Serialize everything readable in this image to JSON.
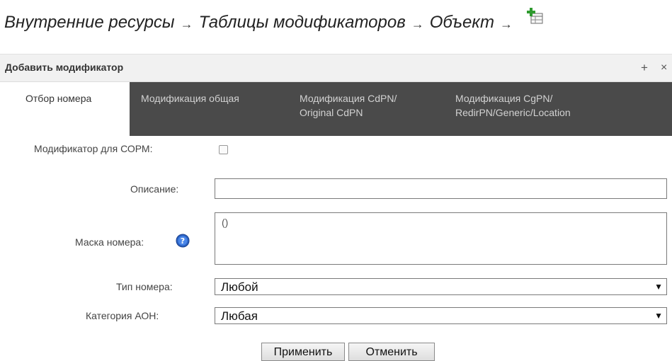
{
  "breadcrumb": {
    "items": [
      "Внутренние ресурсы",
      "Таблицы модификаторов",
      "Объект"
    ],
    "separator": "→",
    "add_icon": "add-table-icon"
  },
  "panel": {
    "title": "Добавить модификатор",
    "plus_label": "+",
    "close_label": "×"
  },
  "tabs": [
    {
      "line1": "Отбор номера",
      "line2": ""
    },
    {
      "line1": "Модификация общая",
      "line2": ""
    },
    {
      "line1": "Модификация CdPN/",
      "line2": "Original CdPN"
    },
    {
      "line1": "Модификация CgPN/",
      "line2": "RedirPN/Generic/Location"
    }
  ],
  "form": {
    "sorm_label": "Модификатор для СОРМ:",
    "sorm_checked": false,
    "description_label": "Описание:",
    "description_value": "",
    "mask_label": "Маска номера:",
    "mask_value": "()",
    "help_icon": "help-icon",
    "number_type_label": "Тип номера:",
    "number_type_value": "Любой",
    "category_label": "Категория АОН:",
    "category_value": "Любая"
  },
  "buttons": {
    "apply": "Применить",
    "cancel": "Отменить"
  },
  "colors": {
    "tab_bar_bg": "#4a4a4a",
    "header_bg": "#f1f1f1",
    "help_icon_blue": "#2a63c4"
  }
}
